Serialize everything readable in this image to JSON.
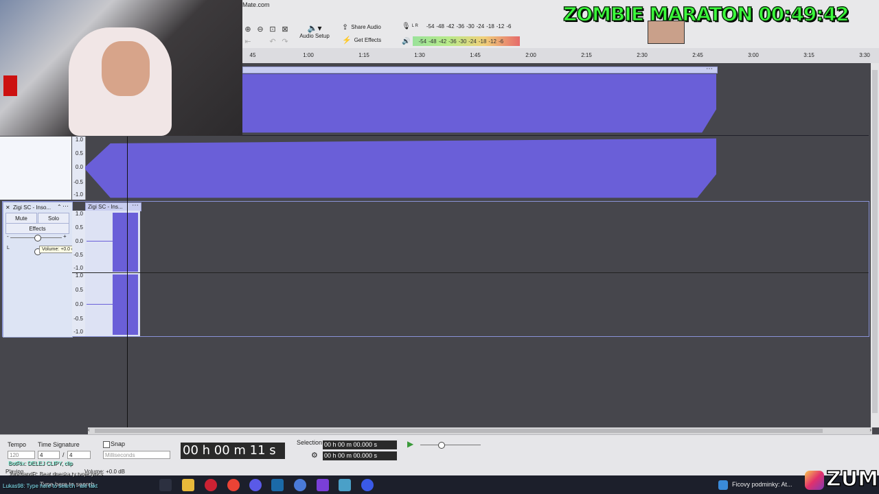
{
  "window": {
    "title_fragment": "Mate.com"
  },
  "toolbar": {
    "audio_setup": "Audio Setup",
    "share_audio": "Share Audio",
    "get_effects": "Get Effects",
    "record_meter": {
      "channels": "L R",
      "scale": [
        "-54",
        "-48",
        "-42",
        "-36",
        "-30",
        "-24",
        "-18",
        "-12",
        "-6"
      ]
    },
    "play_meter": {
      "channels": "L R",
      "scale": [
        "-54",
        "-48",
        "-42",
        "-36",
        "-30",
        "-24",
        "-18",
        "-12",
        "-6"
      ]
    }
  },
  "ruler": {
    "ticks": [
      "45",
      "1:00",
      "1:15",
      "1:30",
      "1:45",
      "2:00",
      "2:15",
      "2:30",
      "2:45",
      "3:00",
      "3:15",
      "3:30"
    ]
  },
  "track1": {
    "axis": [
      "1.0",
      "0.5",
      "0.0",
      "-0.5",
      "-1.0"
    ]
  },
  "track2": {
    "name": "Zigi SC - Inso...",
    "clip_name": "Zigi SC - Ins...",
    "mute": "Mute",
    "solo": "Solo",
    "effects": "Effects",
    "volume_tooltip": "Volume: +0.0 dB",
    "gain_minus": "-",
    "gain_plus": "+",
    "pan_left": "L",
    "axis": [
      "1.0",
      "0.5",
      "0.0",
      "-0.5",
      "-1.0"
    ]
  },
  "overlay": {
    "title": "ZOMBIE MARATON",
    "timer": "00:49:42"
  },
  "bottom": {
    "tempo_label": "Tempo",
    "tempo_value": "120",
    "time_signature_label": "Time Signature",
    "ts_numerator": "4",
    "ts_slash": "/",
    "ts_denominator": "4",
    "snap_label": "Snap",
    "snap_unit": "Milliseconds",
    "time_display": "00 h 00 m 11 s",
    "selection_label": "Selection",
    "selection_start": "00 h 00 m 00.000 s",
    "selection_end": "00 h 00 m 00.000 s",
    "status": "Playing.",
    "status_volume": "Volume: +0.0 dB"
  },
  "chat": {
    "lines": [
      "BotRix: DELEJ CLIPY, clip",
      "JunkbandR: Beat dneska ty tvoje lyrics",
      "Lukas98: Type here to search - ale fakt"
    ]
  },
  "taskbar": {
    "search_placeholder": "Type here to search",
    "notification": "Ficovy podminky: At...",
    "watermark": "ZUMF"
  },
  "colors": {
    "waveform": "#6a5fd8",
    "track_bg": "#46464c",
    "overlay_green": "#3cff3c"
  }
}
